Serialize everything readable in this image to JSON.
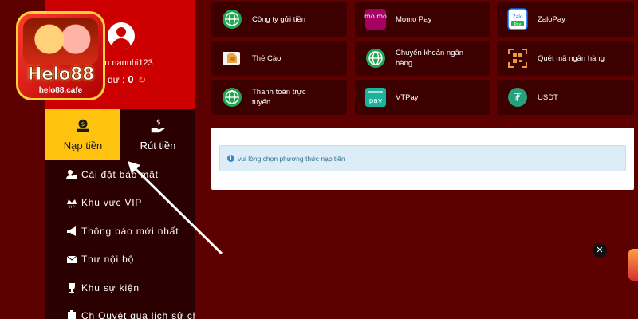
{
  "logo": {
    "brand": "Helo88",
    "site": "helo88.cafe"
  },
  "profile": {
    "username_label": "oàn nannhi123",
    "balance_label": "o dư :",
    "balance_value": "0"
  },
  "tabs": [
    {
      "label": "Nạp tiền",
      "active": true
    },
    {
      "label": "Rút tiền",
      "active": false
    }
  ],
  "menu": [
    {
      "label": "Cài đặt bảo mật",
      "icon": "user-lock-icon"
    },
    {
      "label": "Khu vực VIP",
      "icon": "vip-crown-icon"
    },
    {
      "label": "Thông báo mới nhất",
      "icon": "megaphone-icon"
    },
    {
      "label": "Thư nội bộ",
      "icon": "envelope-icon"
    },
    {
      "label": "Khu sự kiện",
      "icon": "trophy-icon"
    },
    {
      "label": "Ch Quyệt qua lịch sử ch",
      "icon": "clipboard-icon"
    }
  ],
  "payments": [
    {
      "label": "Công ty gửi tiền",
      "icon": "globe-icon"
    },
    {
      "label": "Momo Pay",
      "icon": "momo-icon",
      "icon_text": "mo mo"
    },
    {
      "label": "ZaloPay",
      "icon": "zalopay-icon",
      "icon_text": "Zalo Pay"
    },
    {
      "label": "Thẻ Cào",
      "icon": "scratch-card-icon"
    },
    {
      "label": "Chuyển khoản ngân hàng",
      "icon": "globe-icon"
    },
    {
      "label": "Quét mã ngân hàng",
      "icon": "qr-scan-icon"
    },
    {
      "label": "Thanh toán trực tuyến",
      "icon": "globe-icon"
    },
    {
      "label": "VTPay",
      "icon": "vtpay-icon",
      "icon_text": "pay"
    },
    {
      "label": "USDT",
      "icon": "tether-icon",
      "icon_text": "₮"
    }
  ],
  "notice": {
    "text": "vui lòng chọn phương thức nạp tiền"
  },
  "colors": {
    "background": "#5c0000",
    "sidebar": "#2b0000",
    "profile": "#cc0000",
    "active_tab": "#ffc20e",
    "card": "#3d0000",
    "globe_green": "#22a653",
    "momo_pink": "#a50064",
    "zalo_blue": "#0068ff",
    "vtpay_teal": "#1bb39c",
    "tether_teal": "#26a17b"
  }
}
